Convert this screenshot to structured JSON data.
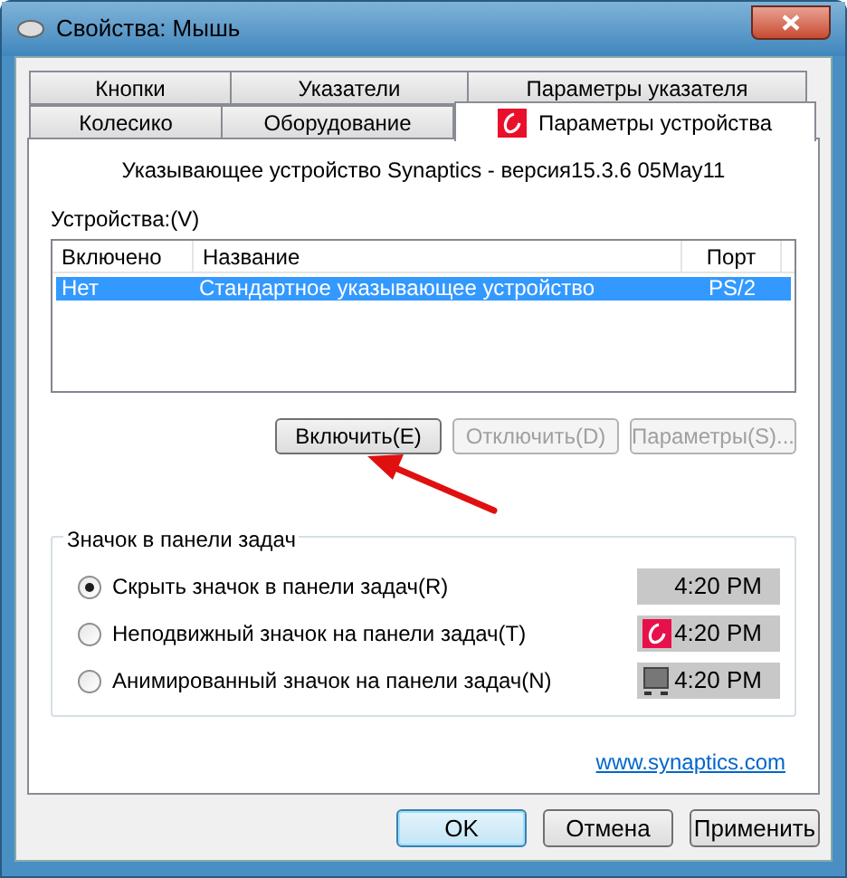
{
  "window": {
    "title": "Свойства: Мышь"
  },
  "tab_rows": [
    {
      "tabs": [
        {
          "label": "Кнопки",
          "selected": false
        },
        {
          "label": "Указатели",
          "selected": false
        },
        {
          "label": "Параметры указателя",
          "selected": false
        }
      ]
    },
    {
      "tabs": [
        {
          "label": "Колесико",
          "selected": false
        },
        {
          "label": "Оборудование",
          "selected": false
        },
        {
          "label": "Параметры устройства",
          "selected": true,
          "kind": "branded"
        }
      ]
    }
  ],
  "version_text": "Указывающее устройство Synaptics - версия15.3.6 05May11",
  "devices": {
    "label": "Устройства:(V)",
    "columns": [
      "Включено",
      "Название",
      "Порт"
    ],
    "rows": [
      {
        "cells": [
          "Нет",
          "Стандартное указывающее устройство",
          "PS/2"
        ],
        "selected": true
      }
    ]
  },
  "device_buttons": [
    {
      "label": "Включить(E)",
      "disabled": false
    },
    {
      "label": "Отключить(D)",
      "disabled": true
    },
    {
      "label": "Параметры(S)...",
      "disabled": true
    }
  ],
  "tray_group": {
    "title": "Значок в панели задач",
    "options": [
      {
        "label": "Скрыть значок в панели задач(R)",
        "selected": true,
        "preview": {
          "kind": "none",
          "time": "4:20 PM"
        }
      },
      {
        "label": "Неподвижный значок на панели задач(T)",
        "selected": false,
        "preview": {
          "kind": "static",
          "time": "4:20 PM"
        }
      },
      {
        "label": "Анимированный значок на панели задач(N)",
        "selected": false,
        "preview": {
          "kind": "animated",
          "time": "4:20 PM"
        }
      }
    ]
  },
  "link": "www.synaptics.com",
  "buttons": [
    {
      "label": "OK",
      "default": true
    },
    {
      "label": "Отмена",
      "default": false
    },
    {
      "label": "Применить",
      "default": false
    }
  ]
}
